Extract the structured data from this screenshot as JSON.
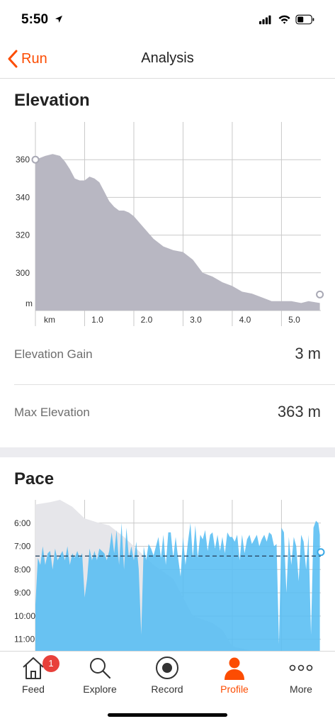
{
  "status": {
    "time": "5:50"
  },
  "nav": {
    "back_label": "Run",
    "title": "Analysis"
  },
  "elevation": {
    "title": "Elevation",
    "stats": [
      {
        "label": "Elevation Gain",
        "value": "3 m"
      },
      {
        "label": "Max Elevation",
        "value": "363 m"
      }
    ]
  },
  "pace": {
    "title": "Pace"
  },
  "chart_data": [
    {
      "type": "area",
      "title": "Elevation",
      "xlabel": "km",
      "ylabel": "m",
      "x_ticks": [
        "1.0",
        "2.0",
        "3.0",
        "4.0",
        "5.0"
      ],
      "y_ticks": [
        "360",
        "340",
        "320",
        "300"
      ],
      "xlim": [
        0,
        5.8
      ],
      "ylim": [
        280,
        380
      ],
      "grid": true,
      "color": "#b8b7c2",
      "series": [
        {
          "x": [
            0,
            0.2,
            0.35,
            0.5,
            0.6,
            0.7,
            0.8,
            0.9,
            1.0,
            1.1,
            1.2,
            1.3,
            1.4,
            1.5,
            1.6,
            1.7,
            1.8,
            1.9,
            2.0,
            2.2,
            2.4,
            2.6,
            2.8,
            3.0,
            3.2,
            3.4,
            3.6,
            3.8,
            4.0,
            4.2,
            4.4,
            4.6,
            4.8,
            5.0,
            5.2,
            5.4,
            5.55,
            5.78
          ],
          "y": [
            360,
            362,
            363,
            362,
            359,
            355,
            350,
            349,
            349,
            351,
            350,
            348,
            343,
            338,
            335,
            333,
            333,
            332,
            330,
            324,
            318,
            314,
            312,
            311,
            307,
            300,
            298,
            295,
            293,
            290,
            289,
            287,
            285,
            285,
            285,
            284,
            285,
            284
          ]
        }
      ]
    },
    {
      "type": "area",
      "title": "Pace",
      "y_ticks": [
        "6:00",
        "7:00",
        "8:00",
        "9:00",
        "10:00",
        "11:00"
      ],
      "x_ticks": [],
      "xlim": [
        0,
        5.8
      ],
      "ylim": [
        5.0,
        11.5
      ],
      "y_inverted": true,
      "grid": true,
      "color": "#56bdf2",
      "average_pace": "7:25",
      "average_value": 7.42,
      "series": [
        {
          "name": "pace",
          "x": [
            0,
            0.05,
            0.1,
            0.15,
            0.2,
            0.25,
            0.3,
            0.35,
            0.4,
            0.45,
            0.5,
            0.55,
            0.6,
            0.65,
            0.7,
            0.75,
            0.8,
            0.85,
            0.9,
            0.95,
            1.0,
            1.05,
            1.1,
            1.15,
            1.2,
            1.25,
            1.3,
            1.35,
            1.4,
            1.45,
            1.5,
            1.55,
            1.6,
            1.65,
            1.7,
            1.75,
            1.8,
            1.85,
            1.9,
            1.95,
            2.0,
            2.05,
            2.1,
            2.15,
            2.2,
            2.25,
            2.3,
            2.35,
            2.4,
            2.45,
            2.5,
            2.55,
            2.6,
            2.65,
            2.7,
            2.75,
            2.8,
            2.85,
            2.9,
            2.95,
            3.0,
            3.05,
            3.1,
            3.15,
            3.2,
            3.25,
            3.3,
            3.35,
            3.4,
            3.45,
            3.5,
            3.55,
            3.6,
            3.65,
            3.7,
            3.75,
            3.8,
            3.85,
            3.9,
            3.95,
            4.0,
            4.05,
            4.1,
            4.15,
            4.2,
            4.25,
            4.3,
            4.35,
            4.4,
            4.45,
            4.5,
            4.55,
            4.6,
            4.65,
            4.7,
            4.75,
            4.8,
            4.85,
            4.9,
            4.95,
            5.0,
            5.05,
            5.1,
            5.15,
            5.2,
            5.25,
            5.3,
            5.35,
            5.4,
            5.45,
            5.5,
            5.55,
            5.6,
            5.65,
            5.7,
            5.75,
            5.78
          ],
          "y": [
            9.5,
            7.5,
            7.8,
            7.0,
            7.8,
            7.3,
            7.2,
            8.0,
            7.1,
            7.6,
            7.4,
            7.2,
            7.6,
            7.0,
            7.8,
            7.3,
            7.5,
            7.2,
            7.5,
            7.3,
            9.2,
            8.4,
            7.1,
            7.6,
            7.2,
            7.6,
            7.1,
            7.2,
            7.3,
            7.6,
            7.2,
            6.4,
            7.3,
            6.3,
            7.8,
            6.0,
            8.0,
            6.2,
            7.5,
            7.0,
            7.6,
            6.8,
            8.0,
            10.8,
            7.0,
            7.6,
            6.9,
            7.1,
            7.4,
            7.0,
            6.6,
            7.5,
            6.5,
            7.8,
            6.4,
            6.4,
            7.5,
            6.6,
            7.5,
            8.3,
            6.6,
            7.8,
            6.8,
            6.0,
            7.5,
            6.1,
            7.5,
            6.5,
            6.7,
            6.3,
            7.2,
            6.5,
            6.4,
            7.1,
            6.5,
            7.2,
            6.6,
            7.3,
            6.4,
            6.6,
            6.6,
            6.8,
            6.5,
            7.6,
            6.5,
            7.3,
            6.7,
            6.5,
            6.9,
            6.7,
            6.5,
            7.0,
            6.7,
            6.5,
            6.8,
            6.4,
            6.5,
            7.0,
            6.9,
            11.2,
            6.2,
            6.4,
            9.0,
            6.6,
            7.8,
            6.6,
            7.0,
            8.5,
            6.5,
            6.8,
            8.0,
            6.5,
            10.8,
            6.2,
            5.9,
            6.0,
            6.5
          ]
        },
        {
          "name": "elevation-overlay",
          "x": [
            0,
            0.3,
            0.5,
            0.75,
            1.0,
            1.3,
            1.5,
            1.8,
            2.0,
            2.4,
            2.8,
            3.2,
            3.6,
            3.8,
            4.0,
            4.4,
            4.8,
            5.2,
            5.6,
            5.78
          ],
          "y": [
            5.2,
            5.1,
            5.0,
            5.3,
            5.8,
            6.0,
            6.1,
            6.6,
            7.0,
            7.8,
            8.4,
            10.0,
            10.3,
            10.6,
            11.3,
            11.5,
            11.5,
            11.5,
            11.5,
            11.5
          ]
        }
      ]
    }
  ],
  "tabs": [
    {
      "label": "Feed",
      "icon": "home-icon",
      "badge": "1"
    },
    {
      "label": "Explore",
      "icon": "search-icon"
    },
    {
      "label": "Record",
      "icon": "record-icon"
    },
    {
      "label": "Profile",
      "icon": "profile-icon",
      "active": true
    },
    {
      "label": "More",
      "icon": "more-icon"
    }
  ],
  "colors": {
    "accent": "#fc4c02",
    "elevation_fill": "#b8b7c2",
    "pace_fill": "#56bdf2",
    "badge": "#e8413b"
  }
}
